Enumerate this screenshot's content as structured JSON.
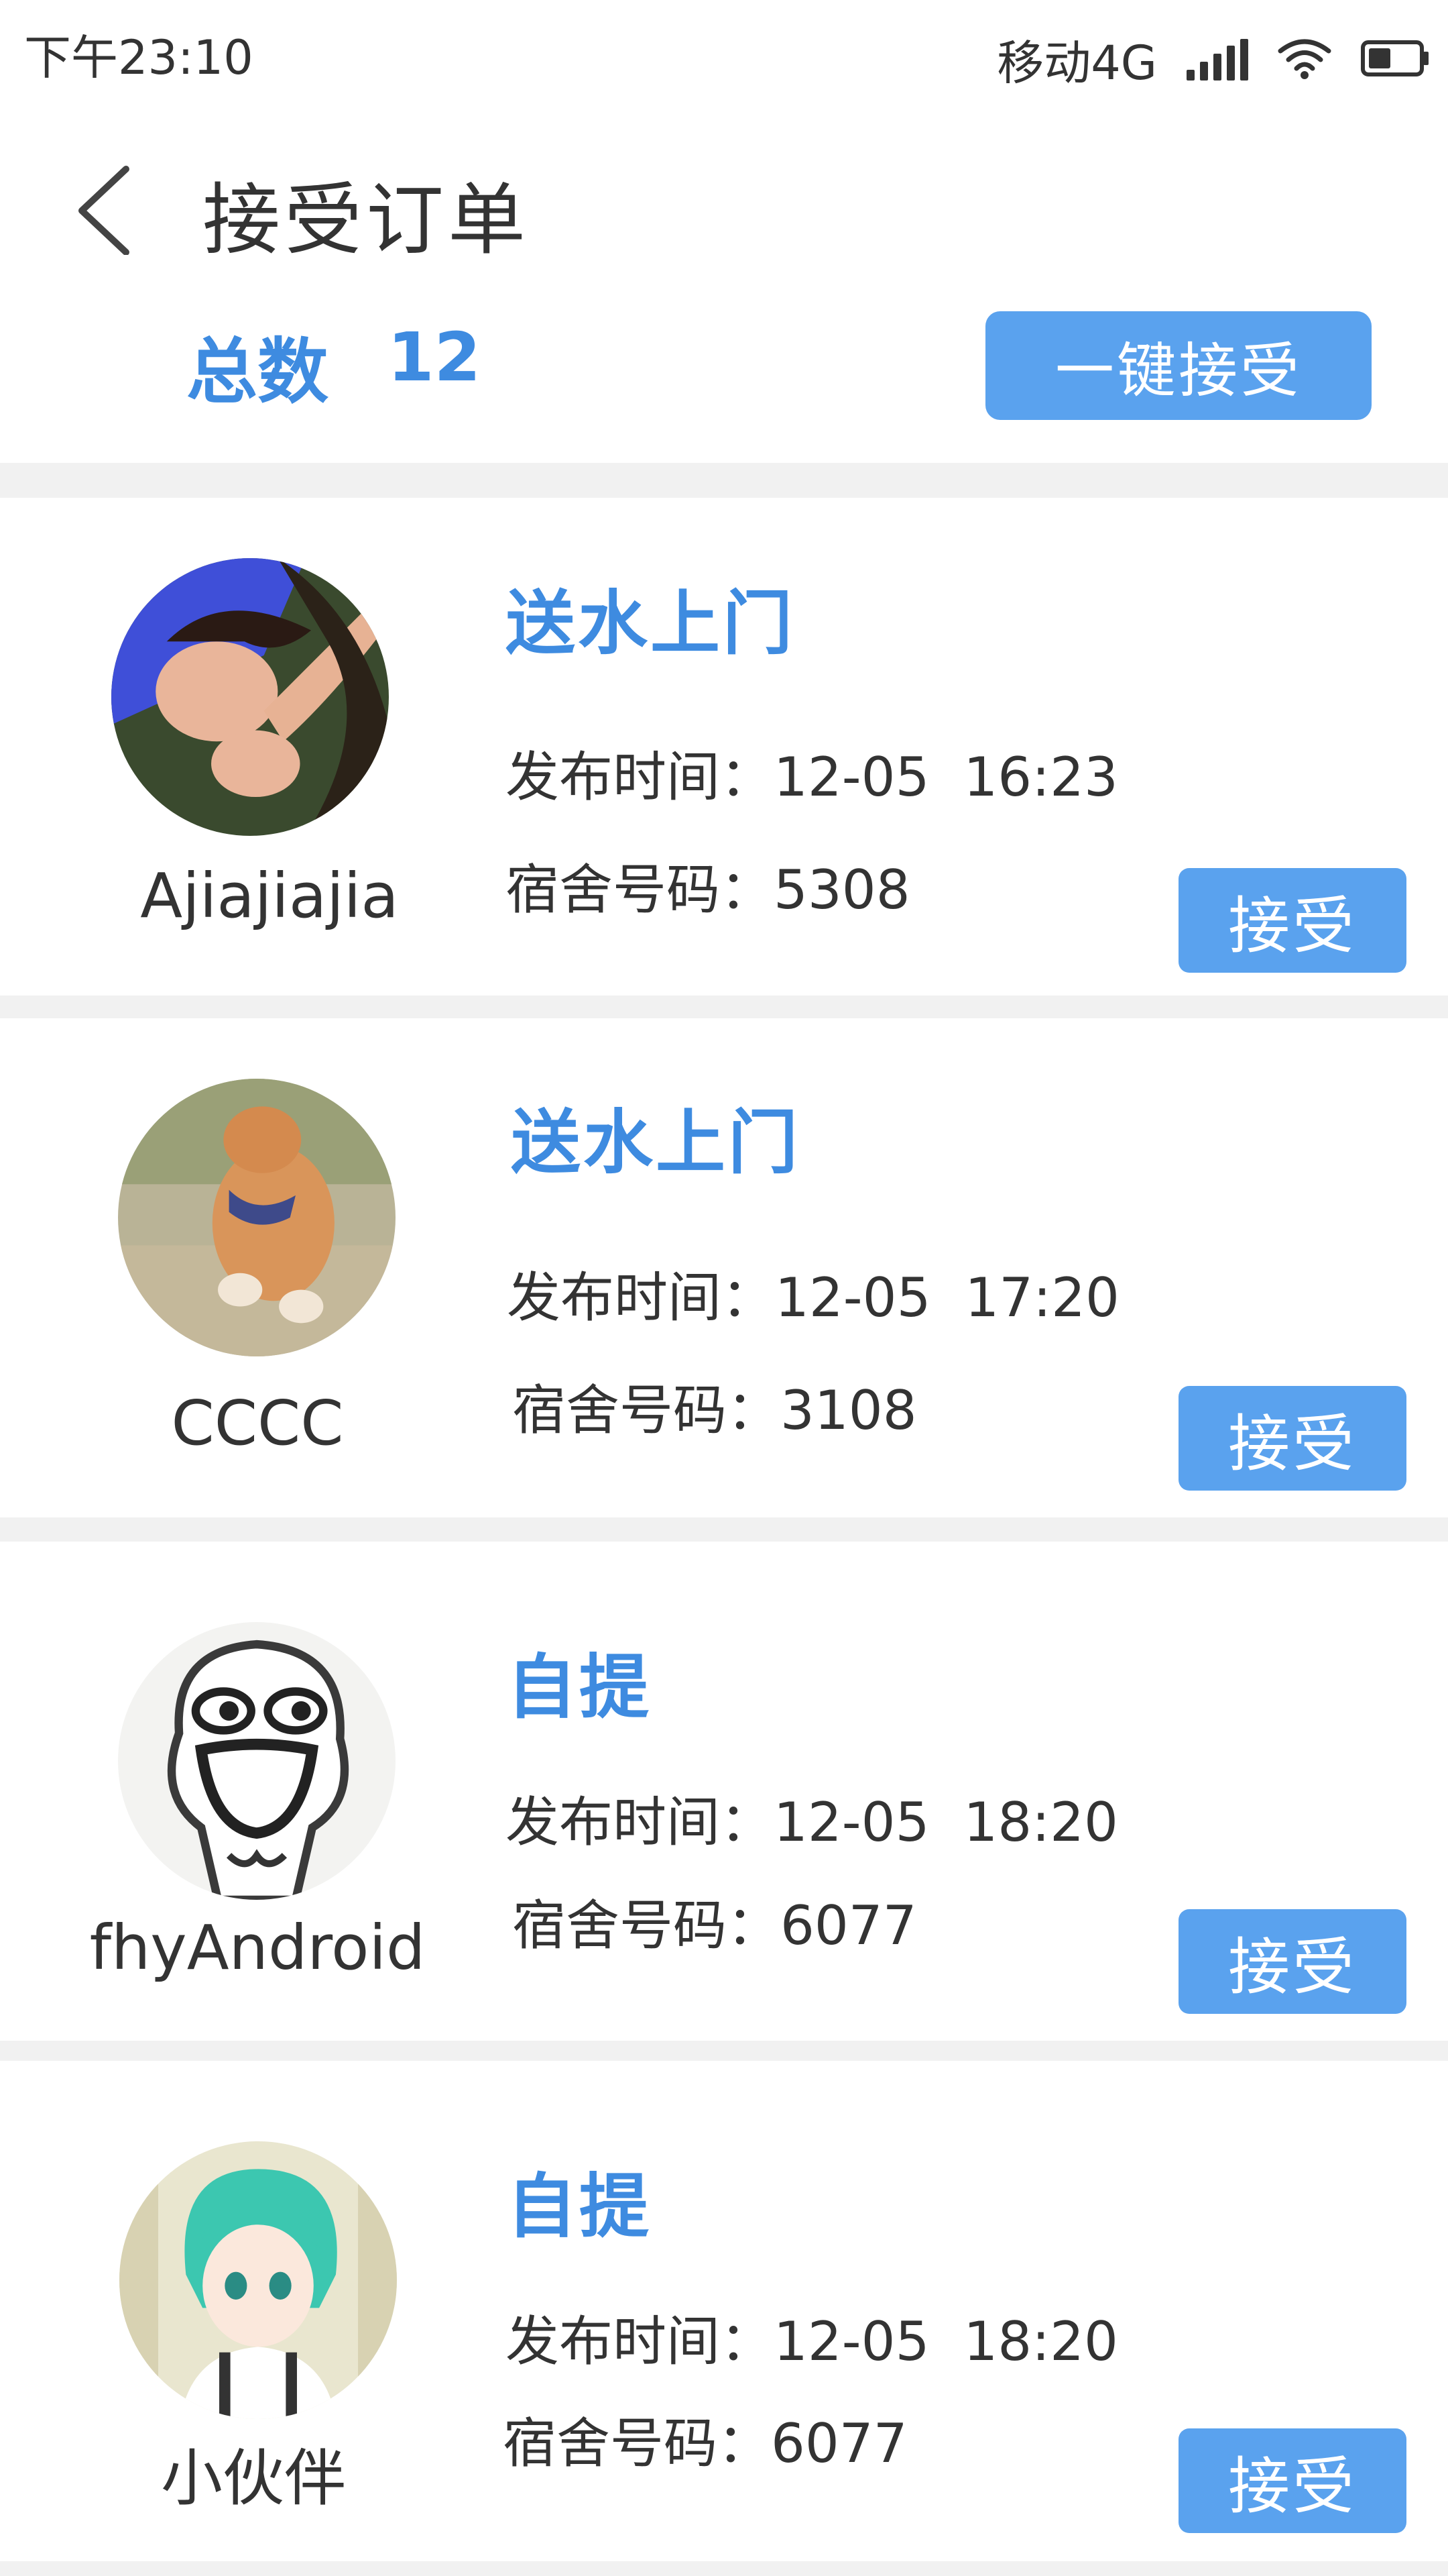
{
  "status_bar": {
    "time": "下午23:10",
    "carrier": "移动4G",
    "icons": [
      "signal-icon",
      "wifi-icon",
      "battery-icon"
    ]
  },
  "header": {
    "title": "接受订单",
    "back_icon": "chevron-left-icon"
  },
  "summary": {
    "total_label": "总数",
    "total_value": "12",
    "accept_all_label": "一键接受"
  },
  "theme": {
    "accent": "#3e8be0",
    "button": "#5aa2ee",
    "divider": "#f1f1f1"
  },
  "orders": [
    {
      "username": "Ajiajiajia",
      "type": "送水上门",
      "time_label": "发布时间：",
      "date": "12-05",
      "time": "16:23",
      "room_label": "宿舍号码：",
      "room": "5308",
      "accept_label": "接受"
    },
    {
      "username": "CCCC",
      "type": "送水上门",
      "time_label": "发布时间：",
      "date": "12-05",
      "time": "17:20",
      "room_label": "宿舍号码：",
      "room": "3108",
      "accept_label": "接受"
    },
    {
      "username": "fhyAndroid",
      "type": "自提",
      "time_label": "发布时间：",
      "date": "12-05",
      "time": "18:20",
      "room_label": "宿舍号码：",
      "room": "6077",
      "accept_label": "接受"
    },
    {
      "username": "小伙伴",
      "type": "自提",
      "time_label": "发布时间：",
      "date": "12-05",
      "time": "18:20",
      "room_label": "宿舍号码：",
      "room": "6077",
      "accept_label": "接受"
    }
  ]
}
